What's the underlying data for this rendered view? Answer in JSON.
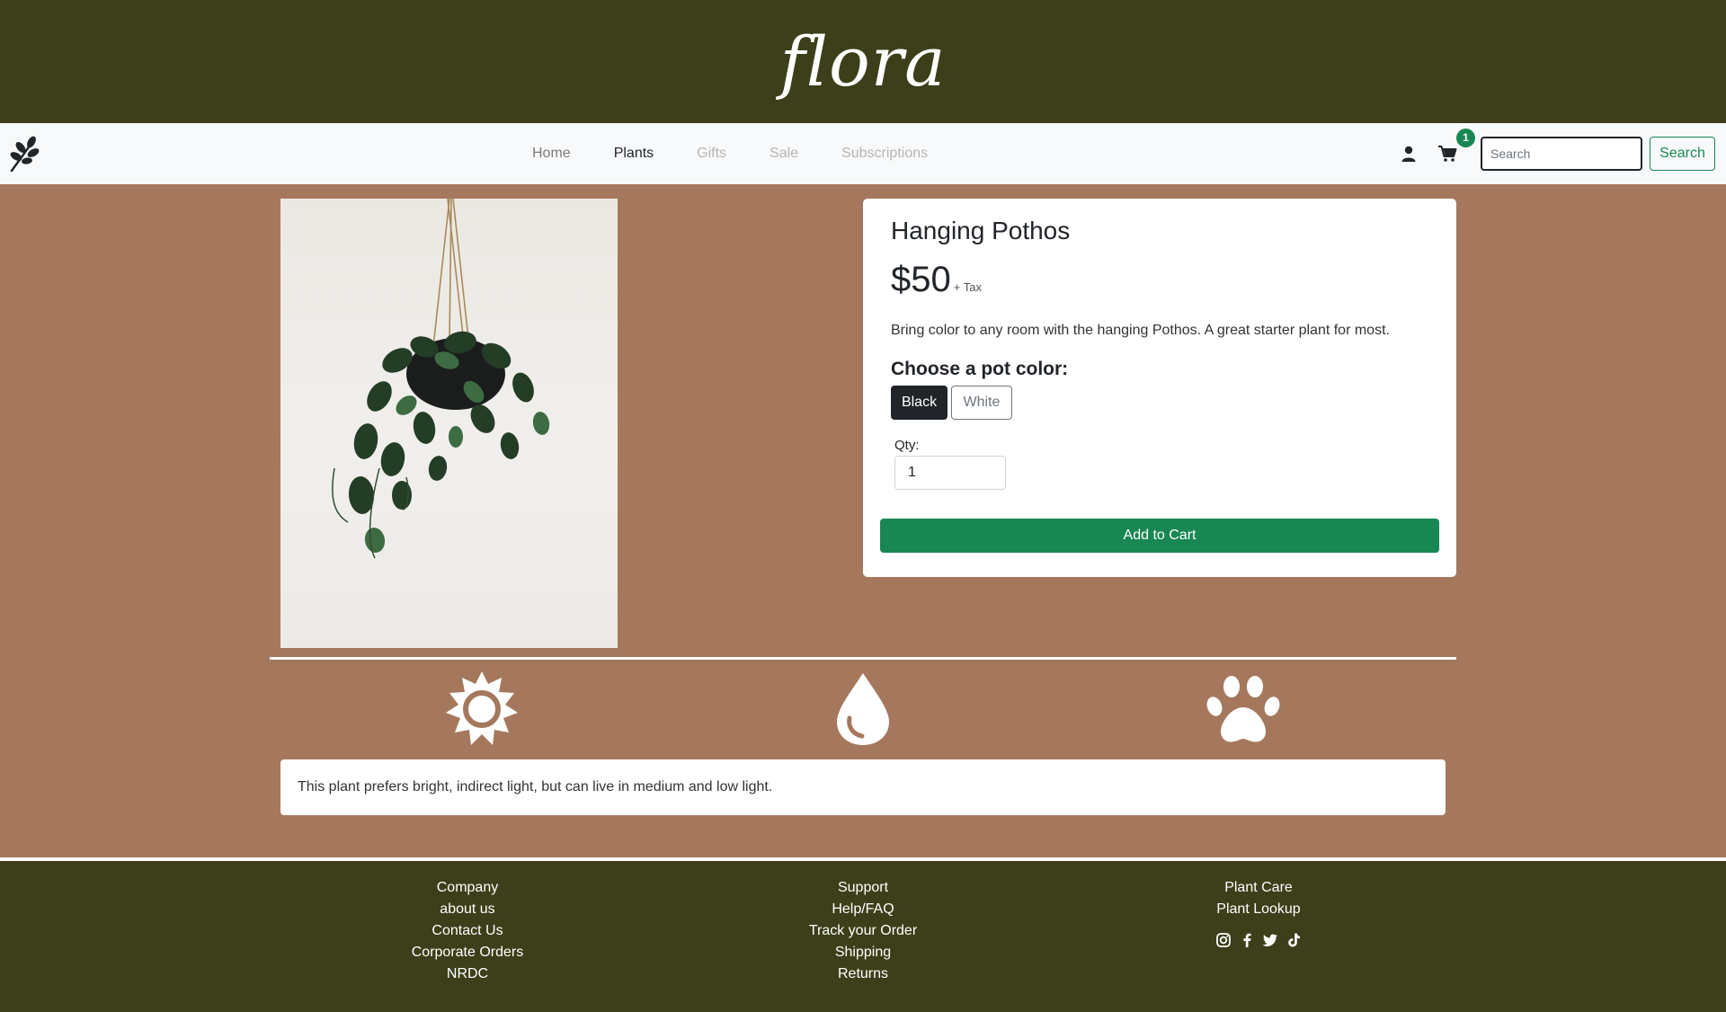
{
  "brand": {
    "name": "flora"
  },
  "nav": {
    "items": [
      {
        "label": "Home",
        "state": "default"
      },
      {
        "label": "Plants",
        "state": "active"
      },
      {
        "label": "Gifts",
        "state": "muted"
      },
      {
        "label": "Sale",
        "state": "muted"
      },
      {
        "label": "Subscriptions",
        "state": "muted"
      }
    ],
    "cart_count": "1",
    "search_placeholder": "Search",
    "search_button": "Search",
    "icons": [
      "leaf-logo-icon",
      "user-icon",
      "cart-icon"
    ]
  },
  "product": {
    "title": "Hanging Pothos",
    "price": "$50",
    "tax_note": "+ Tax",
    "description": "Bring color to any room with the hanging Pothos. A great starter plant for most.",
    "choose_label": "Choose a pot color:",
    "colors": [
      {
        "label": "Black",
        "selected": true
      },
      {
        "label": "White",
        "selected": false
      }
    ],
    "qty_label": "Qty:",
    "qty_value": "1",
    "add_to_cart": "Add to Cart"
  },
  "care": {
    "icons": [
      "sun-icon",
      "water-drop-icon",
      "paw-icon"
    ],
    "info": "This plant prefers bright, indirect light, but can live in medium and low light."
  },
  "footer": {
    "col1": [
      "Company",
      "about us",
      "Contact Us",
      "Corporate Orders",
      "NRDC"
    ],
    "col2": [
      "Support",
      "Help/FAQ",
      "Track your Order",
      "Shipping",
      "Returns"
    ],
    "col3": [
      "Plant Care",
      "Plant Lookup"
    ],
    "social_icons": [
      "instagram-icon",
      "facebook-icon",
      "twitter-icon",
      "tiktok-icon"
    ]
  },
  "colors": {
    "header_bg": "#3c3f19",
    "page_bg": "#a5785d",
    "accent_green": "#198754",
    "dark": "#212529"
  }
}
